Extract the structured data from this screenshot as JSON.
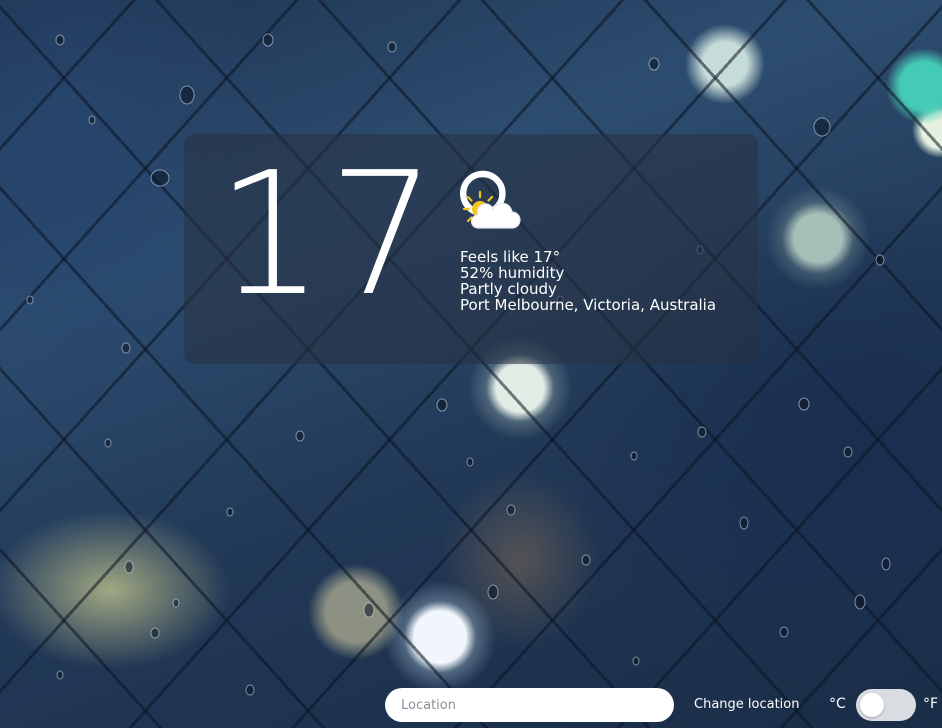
{
  "weather": {
    "temperature": "17°",
    "icon": "partly-cloudy-icon",
    "feels_like": "Feels like 17°",
    "humidity": "52% humidity",
    "condition": "Partly cloudy",
    "location": "Port Melbourne, Victoria, Australia"
  },
  "controls": {
    "location_placeholder": "Location",
    "location_value": "",
    "change_location_label": "Change location",
    "unit_celsius": "°C",
    "unit_fahrenheit": "°F",
    "unit_toggle_state": "celsius"
  },
  "colors": {
    "text": "#ffffff",
    "card_background": "rgba(40,50,65,0.55)",
    "toggle_track": "#d9dde2",
    "sun": "#f5c518"
  }
}
